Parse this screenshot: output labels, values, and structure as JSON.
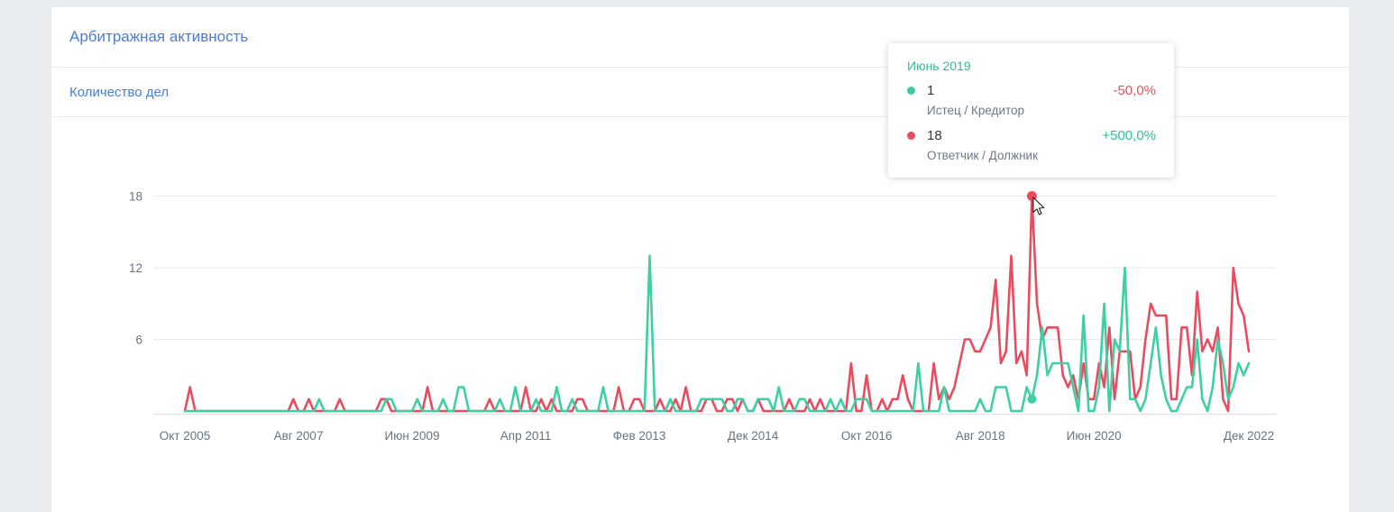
{
  "card": {
    "title": "Арбитражная активность",
    "subtitle": "Количество дел"
  },
  "tooltip": {
    "title": "Июнь 2019",
    "rows": [
      {
        "value": "1",
        "label": "Истец / Кредитор",
        "change": "-50,0%",
        "change_direction": "negative",
        "dot_color": "#3dcba1"
      },
      {
        "value": "18",
        "label": "Ответчик / Должник",
        "change": "+500,0%",
        "change_direction": "positive",
        "dot_color": "#eb4b5e"
      }
    ]
  },
  "colors": {
    "positive": "#2fbc9a",
    "negative": "#e8505b",
    "tooltip_title": "#2fbc9a",
    "title_blue": "#4a7dd3",
    "axis_text": "#68737f",
    "grid": "#e8eaec",
    "axis_line": "#dfe3e6",
    "series_green": "#3ecfa3",
    "series_red": "#ea4c5f"
  },
  "chart_data": {
    "type": "line",
    "title": "Количество дел",
    "x_unit": "month",
    "x_range": [
      "Окт 2005",
      "Дек 2022"
    ],
    "ylim": [
      0,
      18
    ],
    "y_ticks": [
      6,
      12,
      18
    ],
    "grid": "horizontal-only",
    "legend_position": "none",
    "x_ticks": [
      {
        "label": "Окт 2005",
        "index": 0
      },
      {
        "label": "Авг 2007",
        "index": 22
      },
      {
        "label": "Июн 2009",
        "index": 44
      },
      {
        "label": "Апр 2011",
        "index": 66
      },
      {
        "label": "Фев 2013",
        "index": 88
      },
      {
        "label": "Дек 2014",
        "index": 110
      },
      {
        "label": "Окт 2016",
        "index": 132
      },
      {
        "label": "Авг 2018",
        "index": 154
      },
      {
        "label": "Июн 2020",
        "index": 176
      },
      {
        "label": "Дек 2022",
        "index": 206
      }
    ],
    "series": [
      {
        "name": "Ответчик / Должник",
        "color": "#ea4c5f",
        "values": [
          0,
          2,
          0,
          0,
          0,
          0,
          0,
          0,
          0,
          0,
          0,
          0,
          0,
          0,
          0,
          0,
          0,
          0,
          0,
          0,
          0,
          1,
          0,
          0,
          1,
          0,
          0,
          0,
          0,
          0,
          1,
          0,
          0,
          0,
          0,
          0,
          0,
          0,
          1,
          1,
          0,
          0,
          0,
          0,
          0,
          0,
          0,
          2,
          0,
          0,
          0,
          0,
          0,
          0,
          0,
          0,
          0,
          0,
          0,
          1,
          0,
          0,
          0,
          0,
          0,
          0,
          2,
          0,
          0,
          1,
          0,
          1,
          0,
          0,
          0,
          0,
          1,
          1,
          0,
          0,
          0,
          0,
          0,
          0,
          2,
          0,
          0,
          1,
          1,
          0,
          0,
          0,
          1,
          0,
          0,
          1,
          0,
          2,
          0,
          0,
          0,
          1,
          1,
          0,
          0,
          1,
          1,
          0,
          1,
          0,
          0,
          1,
          0,
          0,
          0,
          0,
          0,
          1,
          0,
          0,
          0,
          1,
          0,
          1,
          0,
          0,
          0,
          0,
          0,
          4,
          0,
          0,
          3,
          0,
          0,
          1,
          0,
          1,
          1,
          3,
          1,
          0,
          0,
          0,
          0,
          4,
          1,
          2,
          1,
          2,
          4,
          6,
          6,
          5,
          5,
          6,
          7,
          11,
          4,
          5,
          13,
          4,
          5,
          3,
          18,
          9,
          6,
          7,
          7,
          7,
          3,
          2,
          3,
          1,
          4,
          1,
          1,
          4,
          2,
          7,
          1,
          5,
          5,
          5,
          1,
          2,
          6,
          9,
          8,
          8,
          8,
          1,
          1,
          7,
          7,
          3,
          10,
          5,
          6,
          5,
          7,
          1,
          0,
          12,
          9,
          8,
          5
        ]
      },
      {
        "name": "Истец / Кредитор",
        "color": "#3ecfa3",
        "values": [
          0,
          0,
          0,
          0,
          0,
          0,
          0,
          0,
          0,
          0,
          0,
          0,
          0,
          0,
          0,
          0,
          0,
          0,
          0,
          0,
          0,
          0,
          0,
          0,
          0,
          0,
          1,
          0,
          0,
          0,
          0,
          0,
          0,
          0,
          0,
          0,
          0,
          0,
          0,
          1,
          1,
          0,
          0,
          0,
          0,
          1,
          0,
          0,
          0,
          0,
          1,
          0,
          0,
          2,
          2,
          0,
          0,
          0,
          0,
          0,
          0,
          1,
          0,
          0,
          2,
          0,
          0,
          0,
          1,
          0,
          0,
          0,
          2,
          0,
          0,
          1,
          0,
          0,
          0,
          0,
          0,
          2,
          0,
          0,
          0,
          0,
          0,
          0,
          0,
          0,
          13,
          0,
          0,
          0,
          1,
          0,
          0,
          0,
          0,
          0,
          1,
          1,
          1,
          1,
          1,
          0,
          0,
          1,
          1,
          0,
          0,
          1,
          1,
          1,
          0,
          2,
          0,
          0,
          0,
          1,
          1,
          0,
          0,
          0,
          0,
          1,
          0,
          1,
          0,
          0,
          1,
          1,
          1,
          0,
          0,
          0,
          0,
          0,
          0,
          0,
          0,
          0,
          4,
          0,
          0,
          0,
          0,
          2,
          0,
          0,
          0,
          0,
          0,
          0,
          1,
          0,
          0,
          2,
          2,
          2,
          0,
          0,
          0,
          2,
          1,
          3,
          7,
          3,
          4,
          4,
          4,
          4,
          2,
          0,
          8,
          0,
          0,
          2,
          9,
          0,
          6,
          5,
          12,
          1,
          1,
          0,
          1,
          4,
          7,
          3,
          1,
          0,
          0,
          1,
          2,
          2,
          6,
          1,
          0,
          2,
          6,
          4,
          1,
          2,
          4,
          3,
          4
        ]
      }
    ],
    "hover_point": {
      "index": 164,
      "month": "Июнь 2019",
      "values": {
        "Истец / Кредитор": 1,
        "Ответчик / Должник": 18
      }
    }
  }
}
